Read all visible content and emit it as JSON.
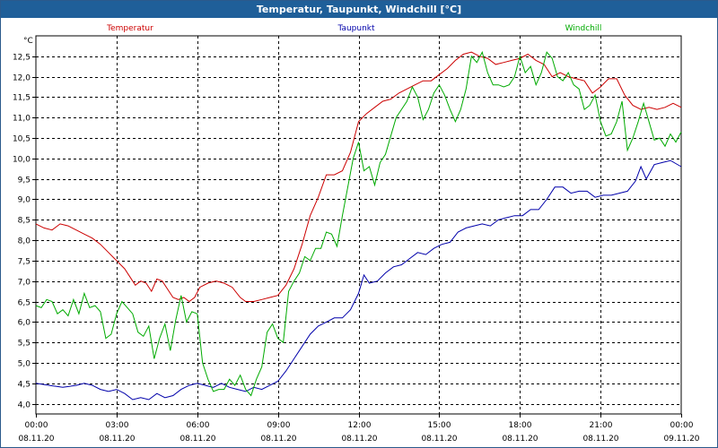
{
  "window": {
    "title": "Temperatur, Taupunkt, Windchill [°C]"
  },
  "chart_data": {
    "type": "line",
    "title": "Temperatur, Taupunkt, Windchill [°C]",
    "ylabel": "°C",
    "xlim": [
      0,
      24
    ],
    "ylim": [
      3.75,
      13.0
    ],
    "yticks": [
      4.0,
      4.5,
      5.0,
      5.5,
      6.0,
      6.5,
      7.0,
      7.5,
      8.0,
      8.5,
      9.0,
      9.5,
      10.0,
      10.5,
      11.0,
      11.5,
      12.0,
      12.5
    ],
    "ytick_labels": [
      "4,0",
      "4,5",
      "5,0",
      "5,5",
      "6,0",
      "6,5",
      "7,0",
      "7,5",
      "8,0",
      "8,5",
      "9,0",
      "9,5",
      "10,0",
      "10,5",
      "11,0",
      "11,5",
      "12,0",
      "12,5"
    ],
    "xtick_times": [
      "00:00",
      "03:00",
      "06:00",
      "09:00",
      "12:00",
      "15:00",
      "18:00",
      "21:00",
      "00:00"
    ],
    "xtick_dates": [
      "08.11.20",
      "08.11.20",
      "08.11.20",
      "08.11.20",
      "08.11.20",
      "08.11.20",
      "08.11.20",
      "08.11.20",
      "09.11.20"
    ],
    "grid": true,
    "colors": {
      "axis": "#000000",
      "grid": "#000000",
      "title_bar": "#1f5f99"
    },
    "series": [
      {
        "name": "Temperatur",
        "color": "#cc0000",
        "points": [
          [
            0,
            8.4
          ],
          [
            0.3,
            8.3
          ],
          [
            0.6,
            8.25
          ],
          [
            0.9,
            8.4
          ],
          [
            1.2,
            8.35
          ],
          [
            1.5,
            8.25
          ],
          [
            1.8,
            8.15
          ],
          [
            2.1,
            8.05
          ],
          [
            2.4,
            7.9
          ],
          [
            2.7,
            7.7
          ],
          [
            3.0,
            7.5
          ],
          [
            3.3,
            7.3
          ],
          [
            3.5,
            7.1
          ],
          [
            3.7,
            6.9
          ],
          [
            3.9,
            7.0
          ],
          [
            4.1,
            6.95
          ],
          [
            4.3,
            6.75
          ],
          [
            4.5,
            7.05
          ],
          [
            4.7,
            7.0
          ],
          [
            4.9,
            6.8
          ],
          [
            5.1,
            6.6
          ],
          [
            5.3,
            6.55
          ],
          [
            5.5,
            6.6
          ],
          [
            5.7,
            6.5
          ],
          [
            5.9,
            6.6
          ],
          [
            6.1,
            6.85
          ],
          [
            6.4,
            6.95
          ],
          [
            6.7,
            7.0
          ],
          [
            7.0,
            6.95
          ],
          [
            7.3,
            6.85
          ],
          [
            7.6,
            6.6
          ],
          [
            7.8,
            6.5
          ],
          [
            8.1,
            6.5
          ],
          [
            8.4,
            6.55
          ],
          [
            8.7,
            6.6
          ],
          [
            9.0,
            6.65
          ],
          [
            9.3,
            6.9
          ],
          [
            9.6,
            7.3
          ],
          [
            9.9,
            7.9
          ],
          [
            10.2,
            8.6
          ],
          [
            10.5,
            9.05
          ],
          [
            10.8,
            9.6
          ],
          [
            11.1,
            9.6
          ],
          [
            11.4,
            9.7
          ],
          [
            11.7,
            10.15
          ],
          [
            12.0,
            10.9
          ],
          [
            12.3,
            11.1
          ],
          [
            12.6,
            11.25
          ],
          [
            12.9,
            11.4
          ],
          [
            13.2,
            11.45
          ],
          [
            13.5,
            11.6
          ],
          [
            13.8,
            11.7
          ],
          [
            14.1,
            11.8
          ],
          [
            14.4,
            11.9
          ],
          [
            14.7,
            11.9
          ],
          [
            15.0,
            12.05
          ],
          [
            15.3,
            12.2
          ],
          [
            15.6,
            12.4
          ],
          [
            15.9,
            12.55
          ],
          [
            16.2,
            12.6
          ],
          [
            16.5,
            12.5
          ],
          [
            16.8,
            12.45
          ],
          [
            17.1,
            12.3
          ],
          [
            17.4,
            12.35
          ],
          [
            17.7,
            12.4
          ],
          [
            18.0,
            12.45
          ],
          [
            18.3,
            12.55
          ],
          [
            18.6,
            12.4
          ],
          [
            18.9,
            12.3
          ],
          [
            19.2,
            12.0
          ],
          [
            19.5,
            12.1
          ],
          [
            19.8,
            12.0
          ],
          [
            20.1,
            11.95
          ],
          [
            20.4,
            11.9
          ],
          [
            20.7,
            11.6
          ],
          [
            21.0,
            11.75
          ],
          [
            21.3,
            11.95
          ],
          [
            21.6,
            11.95
          ],
          [
            21.9,
            11.55
          ],
          [
            22.2,
            11.3
          ],
          [
            22.5,
            11.2
          ],
          [
            22.8,
            11.25
          ],
          [
            23.1,
            11.2
          ],
          [
            23.4,
            11.25
          ],
          [
            23.7,
            11.35
          ],
          [
            24.0,
            11.25
          ]
        ]
      },
      {
        "name": "Taupunkt",
        "color": "#0000aa",
        "points": [
          [
            0,
            4.5
          ],
          [
            0.5,
            4.45
          ],
          [
            1.0,
            4.4
          ],
          [
            1.5,
            4.45
          ],
          [
            1.8,
            4.5
          ],
          [
            2.1,
            4.45
          ],
          [
            2.4,
            4.35
          ],
          [
            2.7,
            4.3
          ],
          [
            3.0,
            4.35
          ],
          [
            3.3,
            4.25
          ],
          [
            3.6,
            4.1
          ],
          [
            3.9,
            4.15
          ],
          [
            4.2,
            4.1
          ],
          [
            4.5,
            4.25
          ],
          [
            4.8,
            4.15
          ],
          [
            5.1,
            4.2
          ],
          [
            5.4,
            4.35
          ],
          [
            5.7,
            4.45
          ],
          [
            6.0,
            4.5
          ],
          [
            6.3,
            4.45
          ],
          [
            6.6,
            4.4
          ],
          [
            6.9,
            4.5
          ],
          [
            7.2,
            4.4
          ],
          [
            7.5,
            4.35
          ],
          [
            7.8,
            4.3
          ],
          [
            8.1,
            4.4
          ],
          [
            8.4,
            4.35
          ],
          [
            8.7,
            4.45
          ],
          [
            9.0,
            4.55
          ],
          [
            9.3,
            4.8
          ],
          [
            9.6,
            5.1
          ],
          [
            9.9,
            5.4
          ],
          [
            10.2,
            5.7
          ],
          [
            10.5,
            5.9
          ],
          [
            10.8,
            6.0
          ],
          [
            11.1,
            6.1
          ],
          [
            11.4,
            6.1
          ],
          [
            11.7,
            6.3
          ],
          [
            12.0,
            6.7
          ],
          [
            12.2,
            7.15
          ],
          [
            12.4,
            6.95
          ],
          [
            12.7,
            7.0
          ],
          [
            13.0,
            7.2
          ],
          [
            13.3,
            7.35
          ],
          [
            13.6,
            7.4
          ],
          [
            13.9,
            7.55
          ],
          [
            14.2,
            7.7
          ],
          [
            14.5,
            7.65
          ],
          [
            14.8,
            7.8
          ],
          [
            15.1,
            7.9
          ],
          [
            15.4,
            7.95
          ],
          [
            15.7,
            8.2
          ],
          [
            16.0,
            8.3
          ],
          [
            16.3,
            8.35
          ],
          [
            16.6,
            8.4
          ],
          [
            16.9,
            8.35
          ],
          [
            17.2,
            8.5
          ],
          [
            17.5,
            8.55
          ],
          [
            17.8,
            8.6
          ],
          [
            18.1,
            8.6
          ],
          [
            18.4,
            8.75
          ],
          [
            18.7,
            8.75
          ],
          [
            19.0,
            9.0
          ],
          [
            19.3,
            9.3
          ],
          [
            19.6,
            9.3
          ],
          [
            19.9,
            9.15
          ],
          [
            20.2,
            9.2
          ],
          [
            20.5,
            9.2
          ],
          [
            20.8,
            9.05
          ],
          [
            21.1,
            9.1
          ],
          [
            21.4,
            9.1
          ],
          [
            21.7,
            9.15
          ],
          [
            22.0,
            9.2
          ],
          [
            22.3,
            9.45
          ],
          [
            22.5,
            9.8
          ],
          [
            22.7,
            9.5
          ],
          [
            23.0,
            9.85
          ],
          [
            23.3,
            9.9
          ],
          [
            23.6,
            9.95
          ],
          [
            24.0,
            9.8
          ]
        ]
      },
      {
        "name": "Windchill",
        "color": "#00aa00",
        "points": [
          [
            0,
            6.4
          ],
          [
            0.2,
            6.35
          ],
          [
            0.4,
            6.55
          ],
          [
            0.6,
            6.5
          ],
          [
            0.8,
            6.2
          ],
          [
            1.0,
            6.3
          ],
          [
            1.2,
            6.15
          ],
          [
            1.4,
            6.55
          ],
          [
            1.6,
            6.2
          ],
          [
            1.8,
            6.7
          ],
          [
            2.0,
            6.35
          ],
          [
            2.2,
            6.4
          ],
          [
            2.4,
            6.25
          ],
          [
            2.6,
            5.6
          ],
          [
            2.8,
            5.7
          ],
          [
            3.0,
            6.2
          ],
          [
            3.2,
            6.5
          ],
          [
            3.4,
            6.35
          ],
          [
            3.6,
            6.2
          ],
          [
            3.8,
            5.75
          ],
          [
            4.0,
            5.65
          ],
          [
            4.2,
            5.9
          ],
          [
            4.4,
            5.1
          ],
          [
            4.6,
            5.6
          ],
          [
            4.8,
            5.95
          ],
          [
            5.0,
            5.3
          ],
          [
            5.2,
            6.05
          ],
          [
            5.4,
            6.65
          ],
          [
            5.6,
            6.0
          ],
          [
            5.8,
            6.25
          ],
          [
            6.0,
            6.2
          ],
          [
            6.2,
            5.0
          ],
          [
            6.4,
            4.6
          ],
          [
            6.6,
            4.3
          ],
          [
            6.8,
            4.35
          ],
          [
            7.0,
            4.35
          ],
          [
            7.2,
            4.6
          ],
          [
            7.4,
            4.45
          ],
          [
            7.6,
            4.7
          ],
          [
            7.8,
            4.35
          ],
          [
            8.0,
            4.2
          ],
          [
            8.2,
            4.6
          ],
          [
            8.4,
            4.9
          ],
          [
            8.6,
            5.75
          ],
          [
            8.8,
            5.95
          ],
          [
            9.0,
            5.6
          ],
          [
            9.2,
            5.5
          ],
          [
            9.4,
            6.75
          ],
          [
            9.6,
            7.0
          ],
          [
            9.8,
            7.2
          ],
          [
            10.0,
            7.6
          ],
          [
            10.2,
            7.5
          ],
          [
            10.4,
            7.8
          ],
          [
            10.6,
            7.8
          ],
          [
            10.8,
            8.2
          ],
          [
            11.0,
            8.15
          ],
          [
            11.2,
            7.85
          ],
          [
            11.4,
            8.6
          ],
          [
            11.6,
            9.3
          ],
          [
            11.8,
            10.0
          ],
          [
            12.0,
            10.4
          ],
          [
            12.2,
            9.7
          ],
          [
            12.4,
            9.8
          ],
          [
            12.6,
            9.35
          ],
          [
            12.8,
            9.9
          ],
          [
            13.0,
            10.1
          ],
          [
            13.2,
            10.55
          ],
          [
            13.4,
            11.0
          ],
          [
            13.6,
            11.2
          ],
          [
            13.8,
            11.4
          ],
          [
            14.0,
            11.75
          ],
          [
            14.2,
            11.5
          ],
          [
            14.4,
            10.95
          ],
          [
            14.6,
            11.2
          ],
          [
            14.8,
            11.6
          ],
          [
            15.0,
            11.8
          ],
          [
            15.2,
            11.55
          ],
          [
            15.4,
            11.2
          ],
          [
            15.6,
            10.9
          ],
          [
            15.8,
            11.2
          ],
          [
            16.0,
            11.7
          ],
          [
            16.2,
            12.5
          ],
          [
            16.4,
            12.35
          ],
          [
            16.6,
            12.6
          ],
          [
            16.8,
            12.1
          ],
          [
            17.0,
            11.8
          ],
          [
            17.2,
            11.8
          ],
          [
            17.4,
            11.75
          ],
          [
            17.6,
            11.8
          ],
          [
            17.8,
            12.0
          ],
          [
            18.0,
            12.5
          ],
          [
            18.2,
            12.1
          ],
          [
            18.4,
            12.25
          ],
          [
            18.6,
            11.8
          ],
          [
            18.8,
            12.1
          ],
          [
            19.0,
            12.6
          ],
          [
            19.2,
            12.45
          ],
          [
            19.4,
            12.0
          ],
          [
            19.6,
            11.9
          ],
          [
            19.8,
            12.1
          ],
          [
            20.0,
            11.8
          ],
          [
            20.2,
            11.7
          ],
          [
            20.4,
            11.2
          ],
          [
            20.6,
            11.3
          ],
          [
            20.8,
            11.55
          ],
          [
            21.0,
            10.9
          ],
          [
            21.2,
            10.55
          ],
          [
            21.4,
            10.6
          ],
          [
            21.6,
            10.9
          ],
          [
            21.8,
            11.4
          ],
          [
            22.0,
            10.2
          ],
          [
            22.2,
            10.5
          ],
          [
            22.4,
            10.9
          ],
          [
            22.6,
            11.35
          ],
          [
            22.8,
            10.9
          ],
          [
            23.0,
            10.45
          ],
          [
            23.2,
            10.5
          ],
          [
            23.4,
            10.3
          ],
          [
            23.6,
            10.6
          ],
          [
            23.8,
            10.4
          ],
          [
            24.0,
            10.65
          ]
        ]
      }
    ]
  }
}
